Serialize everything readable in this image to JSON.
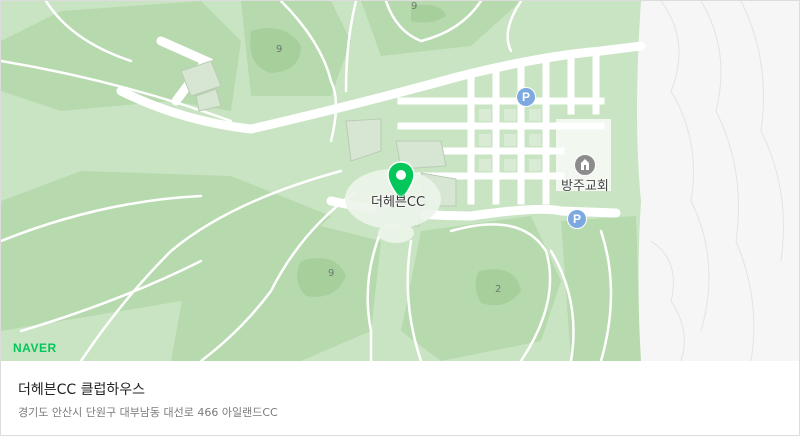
{
  "map": {
    "place_label": "더헤븐CC",
    "church_label": "방주교회",
    "hole_labels": [
      "9",
      "9",
      "9",
      "2"
    ],
    "parking_label": "P",
    "brand": "NAVER",
    "pin_icon": "map-marker-icon",
    "church_icon": "church-icon",
    "colors": {
      "grass": "#c8e4c2",
      "fairway": "#b6d9ad",
      "road": "#ffffff",
      "pin": "#03c75a",
      "parking": "#7ea9e0",
      "brand": "#03c75a"
    }
  },
  "info": {
    "title": "더헤븐CC 클럽하우스",
    "address": "경기도 안산시 단원구 대부남동 대선로 466 아일랜드CC"
  }
}
